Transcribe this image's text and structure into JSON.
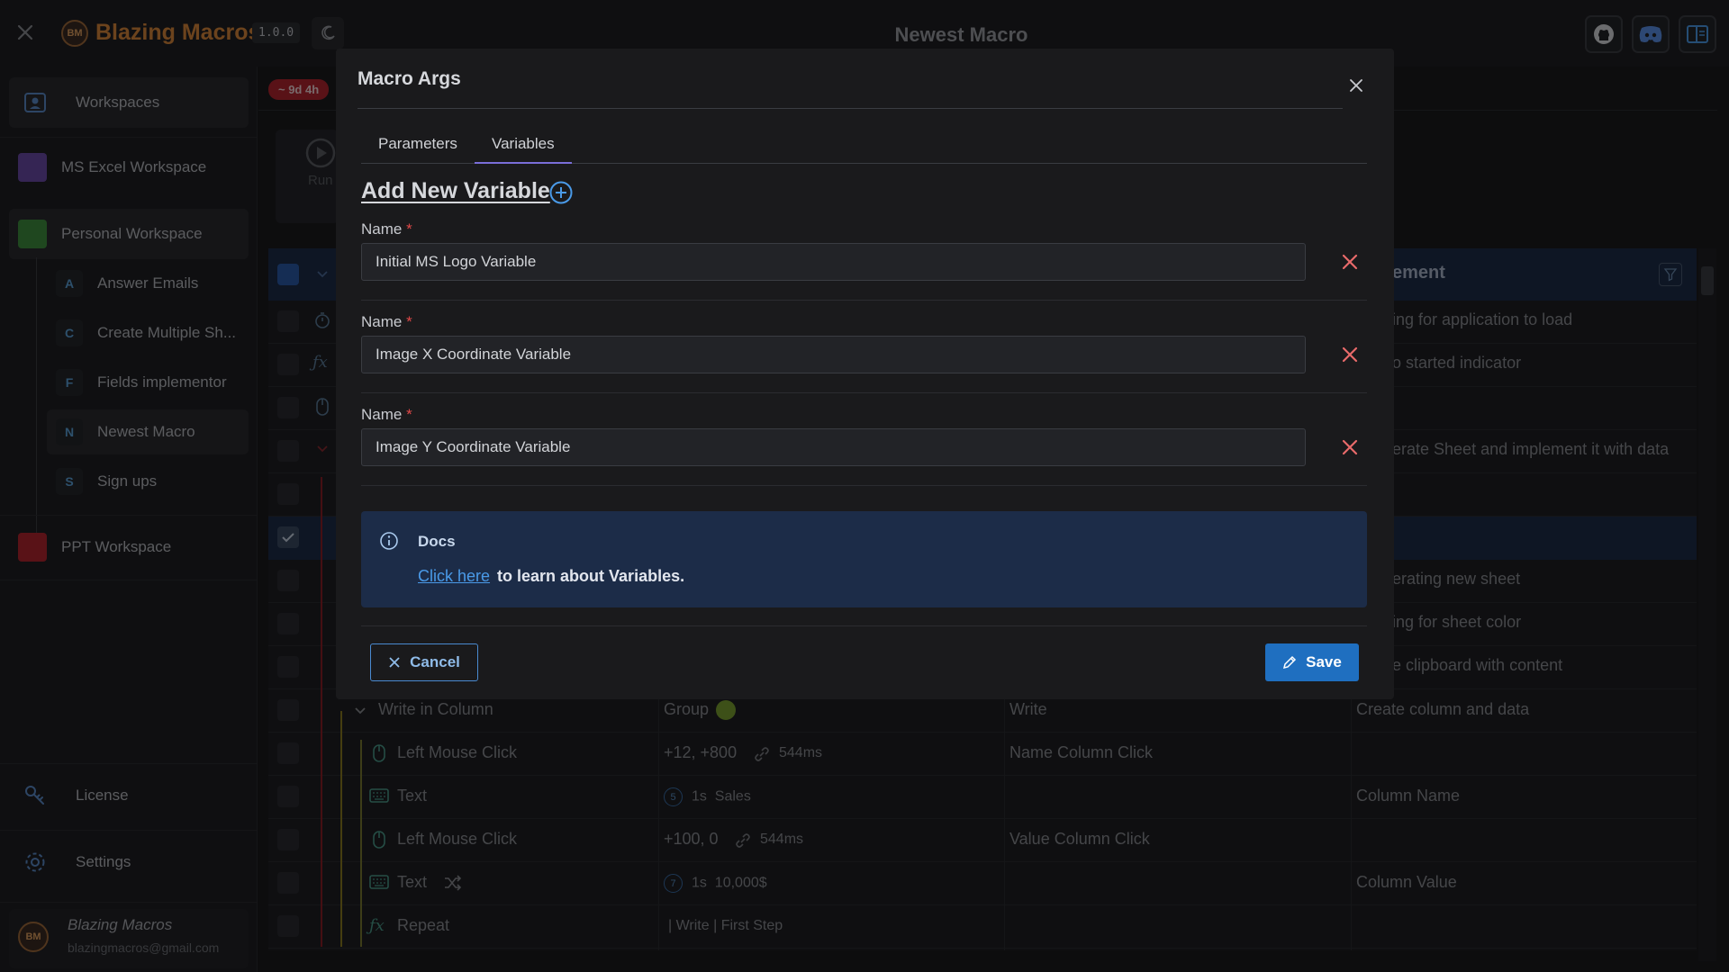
{
  "app": {
    "name": "Blazing Macros",
    "version": "1.0.0",
    "logo_text": "BM",
    "window_title": "Newest Macro"
  },
  "sidebar": {
    "workspaces_label": "Workspaces",
    "workspaces": [
      {
        "label": "MS Excel Workspace",
        "color": "#6b4aa8"
      },
      {
        "label": "Personal Workspace",
        "color": "#3f8f3f"
      },
      {
        "label": "PPT Workspace",
        "color": "#b2242e"
      }
    ],
    "macros": [
      {
        "letter": "A",
        "label": "Answer Emails"
      },
      {
        "letter": "C",
        "label": "Create Multiple Sh..."
      },
      {
        "letter": "F",
        "label": "Fields implementor"
      },
      {
        "letter": "N",
        "label": "Newest Macro"
      },
      {
        "letter": "S",
        "label": "Sign ups"
      }
    ],
    "license_label": "License",
    "settings_label": "Settings",
    "user": {
      "name": "Blazing Macros",
      "email": "blazingmacros@gmail.com"
    }
  },
  "background": {
    "time_badge": "~ 9d 4h",
    "run_label": "Run",
    "grid_header_partial": "ement",
    "comments_partial": [
      "ing for application to load",
      "o started indicator",
      "erate Sheet and implement it with data",
      "erating new sheet",
      "ing for sheet color",
      "e clipboard with content"
    ],
    "rows": [
      {
        "name": "Write in Column",
        "value": "Group",
        "tag": "Write",
        "comment": "Create column and data"
      },
      {
        "name": "Left Mouse Click",
        "value": "+12, +800",
        "delay": "544ms",
        "tag": "Name Column Click",
        "comment": ""
      },
      {
        "name": "Text",
        "badge": "5",
        "value": "1s",
        "extra": "Sales",
        "tag": "",
        "comment": "Column Name"
      },
      {
        "name": "Left Mouse Click",
        "value": "+100, 0",
        "delay": "544ms",
        "tag": "Value Column Click",
        "comment": ""
      },
      {
        "name": "Text",
        "badge": "7",
        "value": "1s",
        "extra": "10,000$",
        "tag": "",
        "comment": "Column Value"
      },
      {
        "name": "Repeat",
        "value": "| Write | First Step",
        "tag": "",
        "comment": ""
      }
    ]
  },
  "modal": {
    "title": "Macro Args",
    "tabs": [
      "Parameters",
      "Variables"
    ],
    "active_tab": "Variables",
    "add_label": "Add New Variable",
    "field_label": "Name",
    "required_mark": "*",
    "variables": [
      "Initial MS Logo Variable",
      "Image X Coordinate Variable",
      "Image Y Coordinate Variable"
    ],
    "docs": {
      "title": "Docs",
      "link_text": "Click here",
      "text": "to learn about Variables."
    },
    "cancel_label": "Cancel",
    "save_label": "Save"
  },
  "colors": {
    "accent": "#1f6fc0",
    "brand": "#d9873a",
    "danger": "#e04848",
    "tab_underline": "#7a6ed8"
  }
}
